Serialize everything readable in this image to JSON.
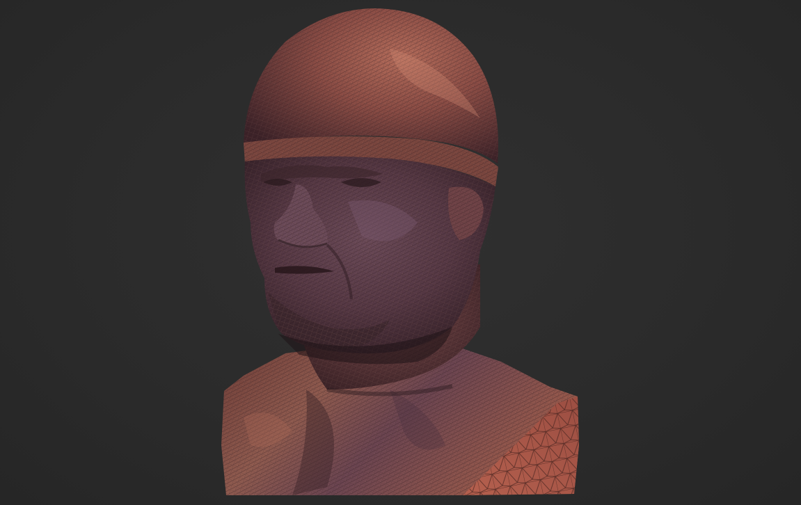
{
  "scene": {
    "subject": "bust-3d-mesh",
    "colors": {
      "background": "#2b2b2b",
      "mesh_base": "#8a4a3e",
      "mesh_highlight": "#c07a66",
      "mesh_shadow": "#3a2228",
      "wire_cut_face": "#a8584a"
    }
  }
}
